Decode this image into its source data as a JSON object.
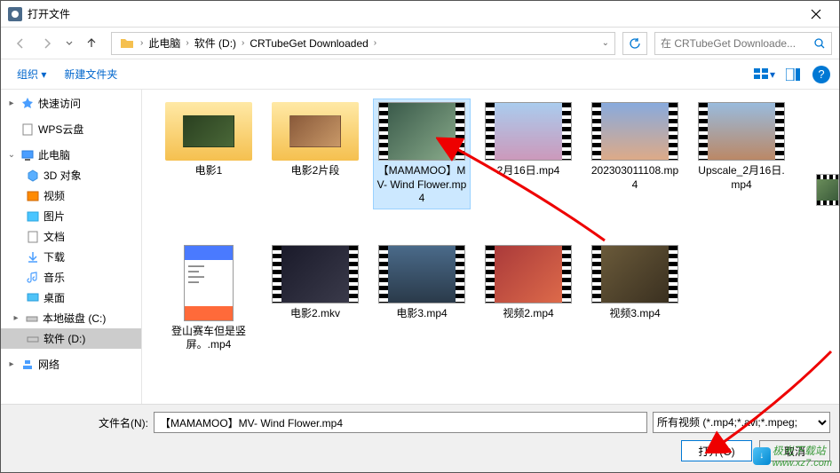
{
  "window": {
    "title": "打开文件"
  },
  "breadcrumb": {
    "items": [
      "此电脑",
      "软件 (D:)",
      "CRTubeGet Downloaded"
    ]
  },
  "search": {
    "placeholder": "在 CRTubeGet Downloade..."
  },
  "toolbar": {
    "organize": "组织 ▾",
    "new_folder": "新建文件夹"
  },
  "sidebar": {
    "quick_access": "快速访问",
    "wps_cloud": "WPS云盘",
    "this_pc": "此电脑",
    "objects_3d": "3D 对象",
    "videos": "视频",
    "pictures": "图片",
    "documents": "文档",
    "downloads": "下载",
    "music": "音乐",
    "desktop": "桌面",
    "local_c": "本地磁盘 (C:)",
    "drive_d": "软件 (D:)",
    "network": "网络"
  },
  "files": {
    "row1": [
      {
        "name": "电影1",
        "type": "folder",
        "bg": "linear-gradient(135deg,#2a4020,#4a6838)"
      },
      {
        "name": "电影2片段",
        "type": "folder",
        "bg": "linear-gradient(135deg,#8a5a3a,#c89868)"
      },
      {
        "name": "【MAMAMOO】MV- Wind Flower.mp4",
        "type": "video",
        "bg": "linear-gradient(135deg,#3a5a4a,#88aa8a)",
        "selected": true
      },
      {
        "name": "2月16日.mp4",
        "type": "video",
        "bg": "linear-gradient(180deg,#aaccee,#cc99bb)"
      },
      {
        "name": "202303011108.mp4",
        "type": "video",
        "bg": "linear-gradient(180deg,#88aadd,#ddaa88)"
      },
      {
        "name": "Upscale_2月16日.mp4",
        "type": "video",
        "bg": "linear-gradient(180deg,#99bbdd,#bb8866)"
      }
    ],
    "row2": [
      {
        "name": "登山赛车但是竖屏。.mp4",
        "type": "app",
        "bg": "#fff"
      },
      {
        "name": "电影2.mkv",
        "type": "video",
        "bg": "linear-gradient(135deg,#1a1a2a,#3a3a4a)"
      },
      {
        "name": "电影3.mp4",
        "type": "video",
        "bg": "linear-gradient(180deg,#4a6a8a,#2a3a4a)"
      },
      {
        "name": "视频2.mp4",
        "type": "video",
        "bg": "linear-gradient(135deg,#aa3a3a,#dd6a4a)"
      },
      {
        "name": "视频3.mp4",
        "type": "video",
        "bg": "linear-gradient(135deg,#6a5a3a,#3a3020)"
      }
    ]
  },
  "bottom": {
    "filename_label": "文件名(N):",
    "filename_value": "【MAMAMOO】MV- Wind Flower.mp4",
    "filetype": "所有视频 (*.mp4;*.avi;*.mpeg;",
    "open": "打开(O)",
    "cancel": "取消"
  },
  "watermark": {
    "text1": "极光下载站",
    "text2": "www.xz7.com"
  }
}
